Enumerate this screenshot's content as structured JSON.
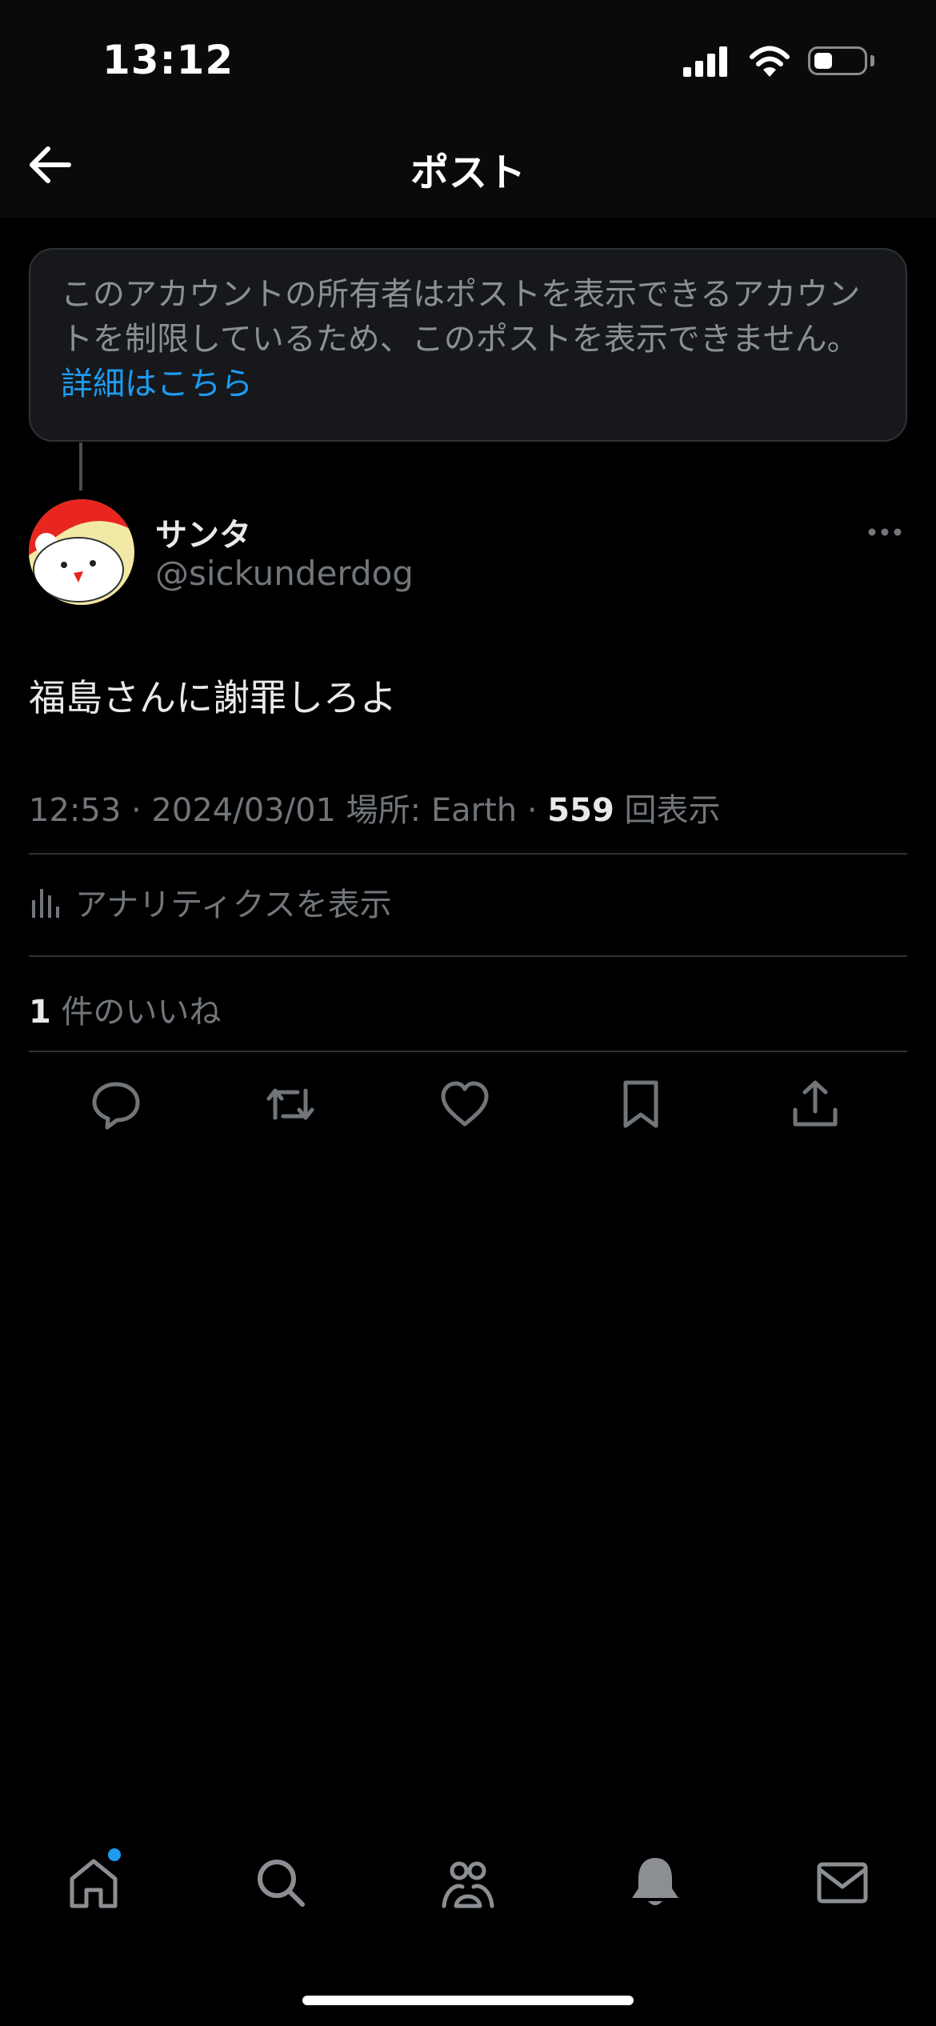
{
  "status_bar": {
    "time": "13:12"
  },
  "header": {
    "title": "ポスト"
  },
  "notice": {
    "text": "このアカウントの所有者はポストを表示できるアカウントを制限しているため、このポストを表示できません。",
    "link": "詳細はこちら"
  },
  "post": {
    "author_name": "サンタ",
    "author_handle": "@sickunderdog",
    "text": "福島さんに謝罪しろよ",
    "meta_prefix": "12:53 · 2024/03/01 場所: Earth · ",
    "views": "559",
    "views_suffix": " 回表示"
  },
  "analytics_label": "アナリティクスを表示",
  "likes": {
    "count": "1",
    "suffix": " 件のいいね"
  },
  "actions": [
    "reply-icon",
    "repost-icon",
    "like-icon",
    "bookmark-icon",
    "share-icon"
  ],
  "tab_bar": [
    "home-icon",
    "search-icon",
    "communities-icon",
    "notifications-icon",
    "messages-icon"
  ],
  "colors": {
    "accent": "#1d9bf0",
    "background": "#000000",
    "muted": "#71767b"
  }
}
